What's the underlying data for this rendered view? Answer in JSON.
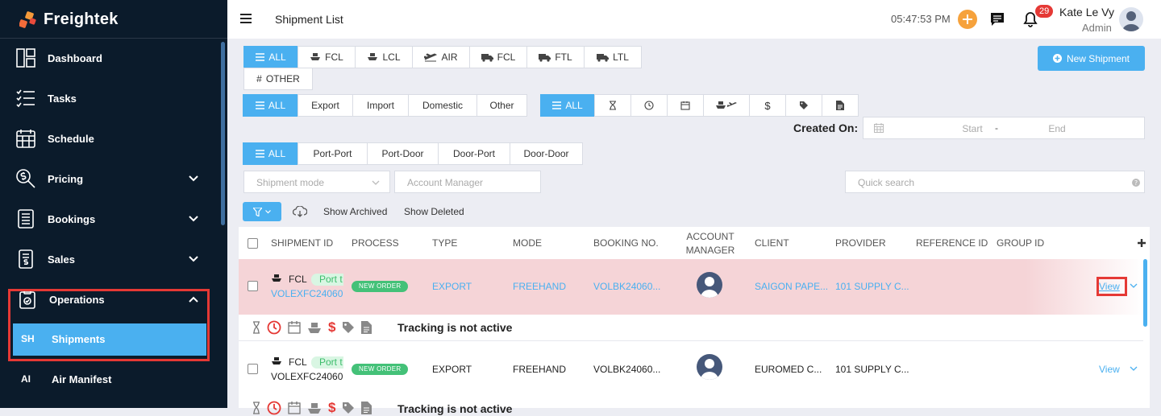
{
  "app": {
    "name": "Freightek"
  },
  "sidebar": {
    "items": [
      {
        "label": "Dashboard",
        "icon": "dashboard-icon"
      },
      {
        "label": "Tasks",
        "icon": "tasks-icon"
      },
      {
        "label": "Schedule",
        "icon": "calendar-icon"
      },
      {
        "label": "Pricing",
        "icon": "pricing-icon"
      },
      {
        "label": "Bookings",
        "icon": "bookings-icon"
      },
      {
        "label": "Sales",
        "icon": "sales-icon"
      },
      {
        "label": "Operations",
        "icon": "operations-icon"
      }
    ],
    "subitems": [
      {
        "abbr": "SH",
        "label": "Shipments",
        "active": true
      },
      {
        "abbr": "AI",
        "label": "Air Manifest",
        "active": false
      }
    ]
  },
  "header": {
    "title": "Shipment List",
    "time": "05:47:53 PM",
    "notification_count": "29",
    "user_name": "Kate Le Vy",
    "user_role": "Admin"
  },
  "filters": {
    "mode_tabs": [
      "ALL",
      "FCL",
      "LCL",
      "AIR",
      "FCL",
      "FTL",
      "LTL",
      "OTHER"
    ],
    "type_tabs": [
      "ALL",
      "Export",
      "Import",
      "Domestic",
      "Other"
    ],
    "status_tabs": [
      "ALL"
    ],
    "route_tabs": [
      "ALL",
      "Port-Port",
      "Port-Door",
      "Door-Port",
      "Door-Door"
    ],
    "new_shipment_label": "New Shipment",
    "created_on_label": "Created On:",
    "date_start_placeholder": "Start",
    "date_separator": "-",
    "date_end_placeholder": "End",
    "shipment_mode_placeholder": "Shipment mode",
    "account_manager_placeholder": "Account Manager",
    "quick_search_placeholder": "Quick search",
    "show_archived": "Show Archived",
    "show_deleted": "Show Deleted"
  },
  "table": {
    "columns": [
      "SHIPMENT ID",
      "PROCESS",
      "TYPE",
      "MODE",
      "BOOKING NO.",
      "ACCOUNT MANAGER",
      "CLIENT",
      "PROVIDER",
      "REFERENCE ID",
      "GROUP ID"
    ],
    "rows": [
      {
        "mode_code": "FCL",
        "route_tag": "Port t",
        "shipment_id": "VOLEXFC24060",
        "process": "NEW ORDER",
        "type": "EXPORT",
        "mode": "FREEHAND",
        "booking_no": "VOLBK24060...",
        "client": "SAIGON PAPE...",
        "provider": "101 SUPPLY C...",
        "action": "View",
        "tracking": "Tracking is not active",
        "highlighted": true
      },
      {
        "mode_code": "FCL",
        "route_tag": "Port t",
        "shipment_id": "VOLEXFC24060",
        "process": "NEW ORDER",
        "type": "EXPORT",
        "mode": "FREEHAND",
        "booking_no": "VOLBK24060...",
        "client": "EUROMED C...",
        "provider": "101 SUPPLY C...",
        "action": "View",
        "tracking": "Tracking is not active",
        "highlighted": false
      }
    ]
  },
  "colors": {
    "accent": "#4ab0f0",
    "sidebar_bg": "#0b1b2b",
    "highlight_row": "#f5d4d7",
    "new_order": "#44c178",
    "alert_red": "#e53935",
    "orange": "#f6a23c"
  }
}
